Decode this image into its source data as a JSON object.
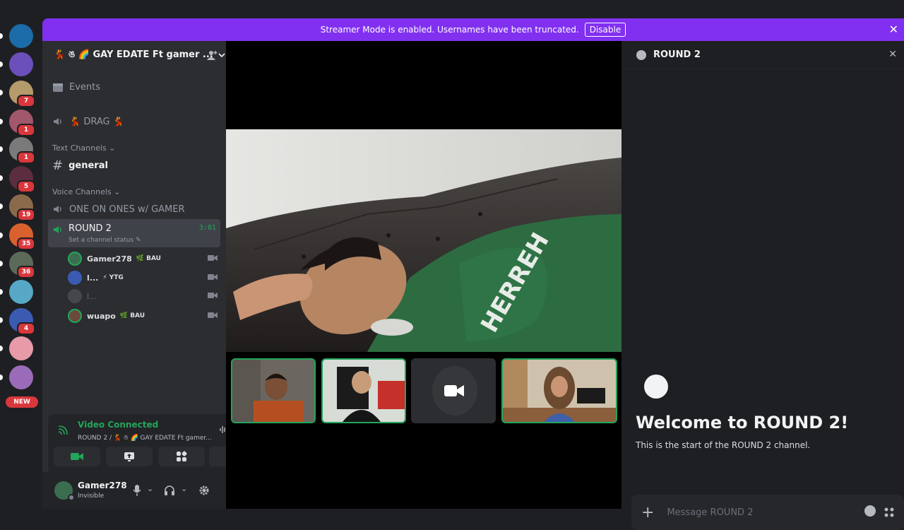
{
  "banner": {
    "text": "Streamer Mode is enabled. Usernames have been truncated.",
    "button": "Disable"
  },
  "rail": {
    "servers": [
      {
        "color": "#1b6ca8",
        "badge": ""
      },
      {
        "color": "#6b4fbb",
        "badge": ""
      },
      {
        "color": "#b59a6b",
        "badge": "7"
      },
      {
        "color": "#a0586a",
        "badge": "1"
      },
      {
        "color": "#7a7a7a",
        "badge": "1"
      },
      {
        "color": "#5b2d3f",
        "badge": "5"
      },
      {
        "color": "#8a6a4a",
        "badge": "19"
      },
      {
        "color": "#d9612e",
        "badge": "35"
      },
      {
        "color": "#5c6a59",
        "badge": "36"
      },
      {
        "color": "#56a8c6",
        "badge": ""
      },
      {
        "color": "#3b5bb3",
        "badge": "4"
      },
      {
        "color": "#e79aa8",
        "badge": ""
      },
      {
        "color": "#9a6bb8",
        "badge": ""
      }
    ],
    "new_label": "NEW"
  },
  "sidebar": {
    "server_name": "💃 ঙ 🌈 GAY EDATE Ft gamer ...",
    "events": "Events",
    "drag_channel": "💃 DRAG 💃",
    "text_category": "Text Channels",
    "text_channel": "general",
    "voice_category": "Voice Channels",
    "voice_channel_1": "ONE ON ONES w/ GAMER",
    "voice_channel_2": "ROUND 2",
    "voice_timer": "3:01",
    "channel_status": "Set a channel status",
    "members": [
      {
        "name": "Gamer278",
        "tag": "🌿 BAU",
        "color": "#3b6e4f"
      },
      {
        "name": "l...",
        "tag": "⚡ YTG",
        "color": "#3b5bb3"
      },
      {
        "name": "l...",
        "tag": "",
        "color": "#555a60"
      },
      {
        "name": "wuapo",
        "tag": "🌿 BAU",
        "color": "#6a4a3a"
      }
    ]
  },
  "voice": {
    "status": "Video Connected",
    "location": "ROUND 2 / 💃 ঙ 🌈 GAY EDATE Ft gamer..."
  },
  "user": {
    "name": "Gamer278",
    "status": "Invisible"
  },
  "chat": {
    "title": "ROUND 2",
    "welcome": "Welcome to ROUND 2!",
    "intro": "This is the start of the ROUND 2 channel.",
    "placeholder": "Message ROUND 2"
  },
  "colors": {
    "accent": "#8130f0",
    "green": "#23a55a",
    "danger": "#da373c"
  }
}
